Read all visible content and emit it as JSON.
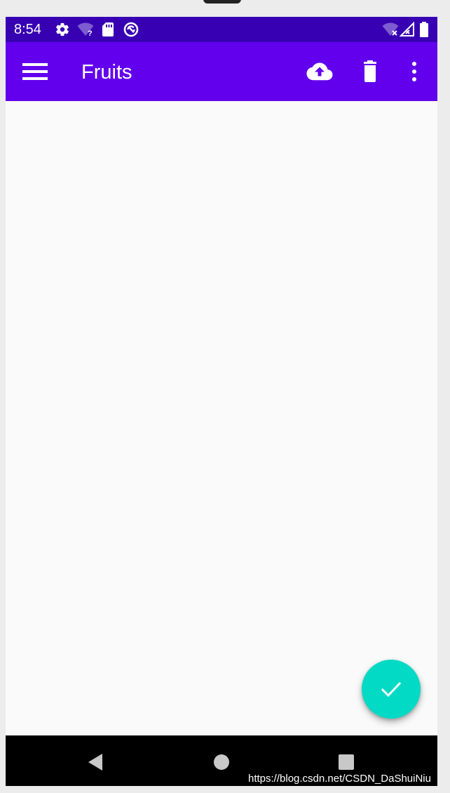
{
  "status_bar": {
    "time": "8:54",
    "icons_left": [
      "settings-icon",
      "wifi-unknown-icon",
      "sd-card-icon",
      "sync-icon"
    ],
    "icons_right": [
      "wifi-off-icon",
      "cellular-off-icon",
      "battery-icon"
    ]
  },
  "app_bar": {
    "title": "Fruits",
    "icons": [
      "menu-icon",
      "cloud-upload-icon",
      "delete-icon",
      "more-vert-icon"
    ]
  },
  "fab": {
    "icon": "check-icon"
  },
  "nav_bar": {
    "icons": [
      "back-icon",
      "home-icon",
      "recents-icon"
    ]
  },
  "watermark": "https://blog.csdn.net/CSDN_DaShuiNiu",
  "colors": {
    "status_bar": "#3700b3",
    "app_bar": "#6200ee",
    "fab": "#03dac5",
    "background": "#fafafa",
    "nav_bar": "#000000"
  }
}
